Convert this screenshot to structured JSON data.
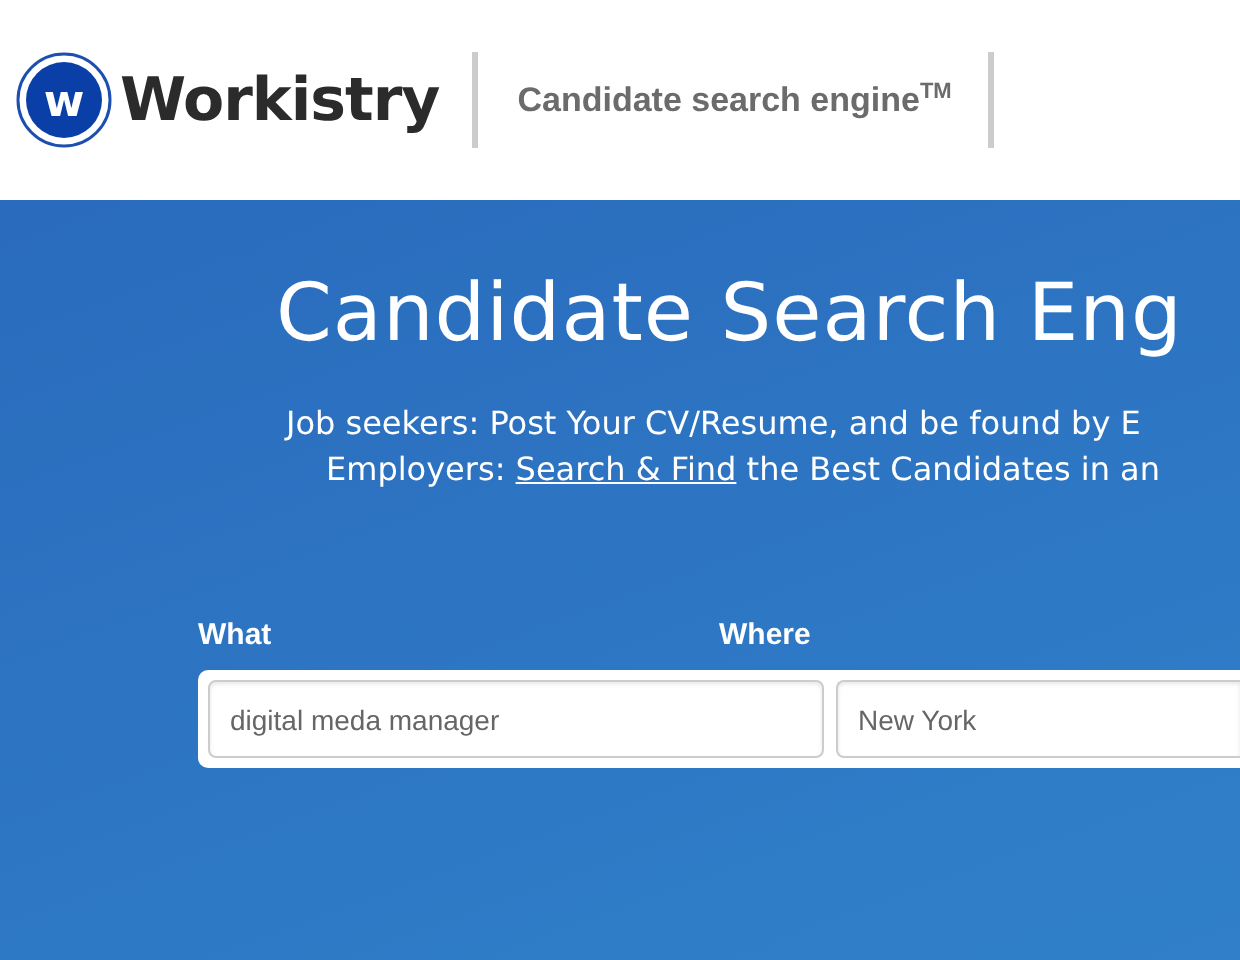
{
  "header": {
    "logo_letter": "w",
    "brand": "Workistry",
    "tagline": "Candidate search engine$^{TM}$"
  },
  "hero": {
    "title": "Candidate Search Eng",
    "lines": [
      {
        "before": "Job seekers: Post Your CV/Resume, and be found by E"
      },
      {
        "before": "Employers: ",
        "link": "Search & Find",
        "after": " the Best Candidates in an"
      }
    ]
  },
  "search": {
    "fields": [
      {
        "label": "What",
        "value": "digital meda manager"
      },
      {
        "label": "Where",
        "value": "New York"
      }
    ]
  }
}
